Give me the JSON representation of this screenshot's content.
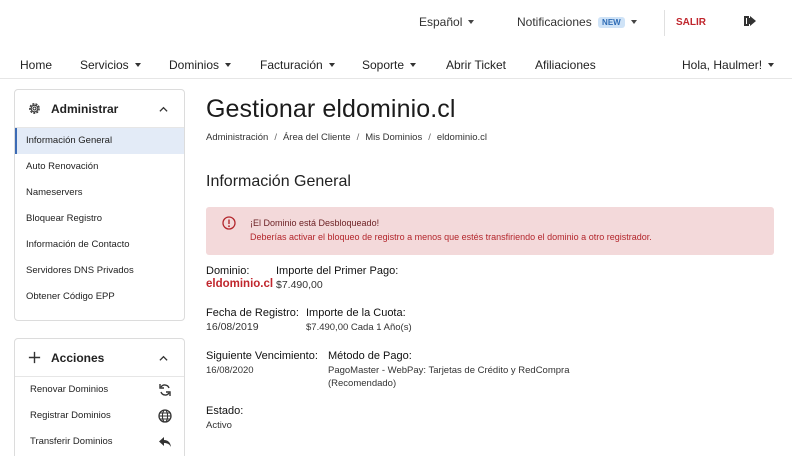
{
  "topbar": {
    "language": "Español",
    "notifications": "Notificaciones",
    "notifications_badge": "NEW",
    "logout": "SALIR"
  },
  "nav": {
    "items": [
      "Home",
      "Servicios",
      "Dominios",
      "Facturación",
      "Soporte",
      "Abrir Ticket",
      "Afiliaciones"
    ],
    "user": "Hola, Haulmer!"
  },
  "sidebar": {
    "admin": {
      "title": "Administrar",
      "items": [
        "Información General",
        "Auto Renovación",
        "Nameservers",
        "Bloquear Registro",
        "Información de Contacto",
        "Servidores DNS Privados",
        "Obtener Código EPP"
      ],
      "active_index": 0
    },
    "actions": {
      "title": "Acciones",
      "items": [
        "Renovar Dominios",
        "Registrar Dominios",
        "Transferir Dominios"
      ]
    }
  },
  "main": {
    "title": "Gestionar eldominio.cl",
    "breadcrumb": [
      "Administración",
      "Área del Cliente",
      "Mis Dominios",
      "eldominio.cl"
    ],
    "section_title": "Información General",
    "alert": {
      "title": "¡El Dominio está Desbloqueado!",
      "text": "Deberías activar el bloqueo de registro a menos que estés transfiriendo el dominio a otro registrador."
    },
    "fields": {
      "domain_label": "Dominio:",
      "domain_value": "eldominio.cl",
      "first_payment_label": "Importe del Primer Pago:",
      "first_payment_value": "$7.490,00",
      "reg_date_label": "Fecha de Registro:",
      "reg_date_value": "16/08/2019",
      "recurring_label": "Importe de la Cuota:",
      "recurring_value": "$7.490,00 Cada 1 Año(s)",
      "next_due_label": "Siguiente Vencimiento:",
      "next_due_value": "16/08/2020",
      "payment_method_label": "Método de Pago:",
      "payment_method_line1": "PagoMaster - WebPay: Tarjetas de Crédito y RedCompra",
      "payment_method_line2": "(Recomendado)",
      "status_label": "Estado:",
      "status_value": "Activo"
    }
  },
  "colors": {
    "accent_red": "#c0262d",
    "alert_bg": "#f3d9da",
    "active_item_bg": "#e3ebf7",
    "badge_bg": "#cfe3f7"
  }
}
